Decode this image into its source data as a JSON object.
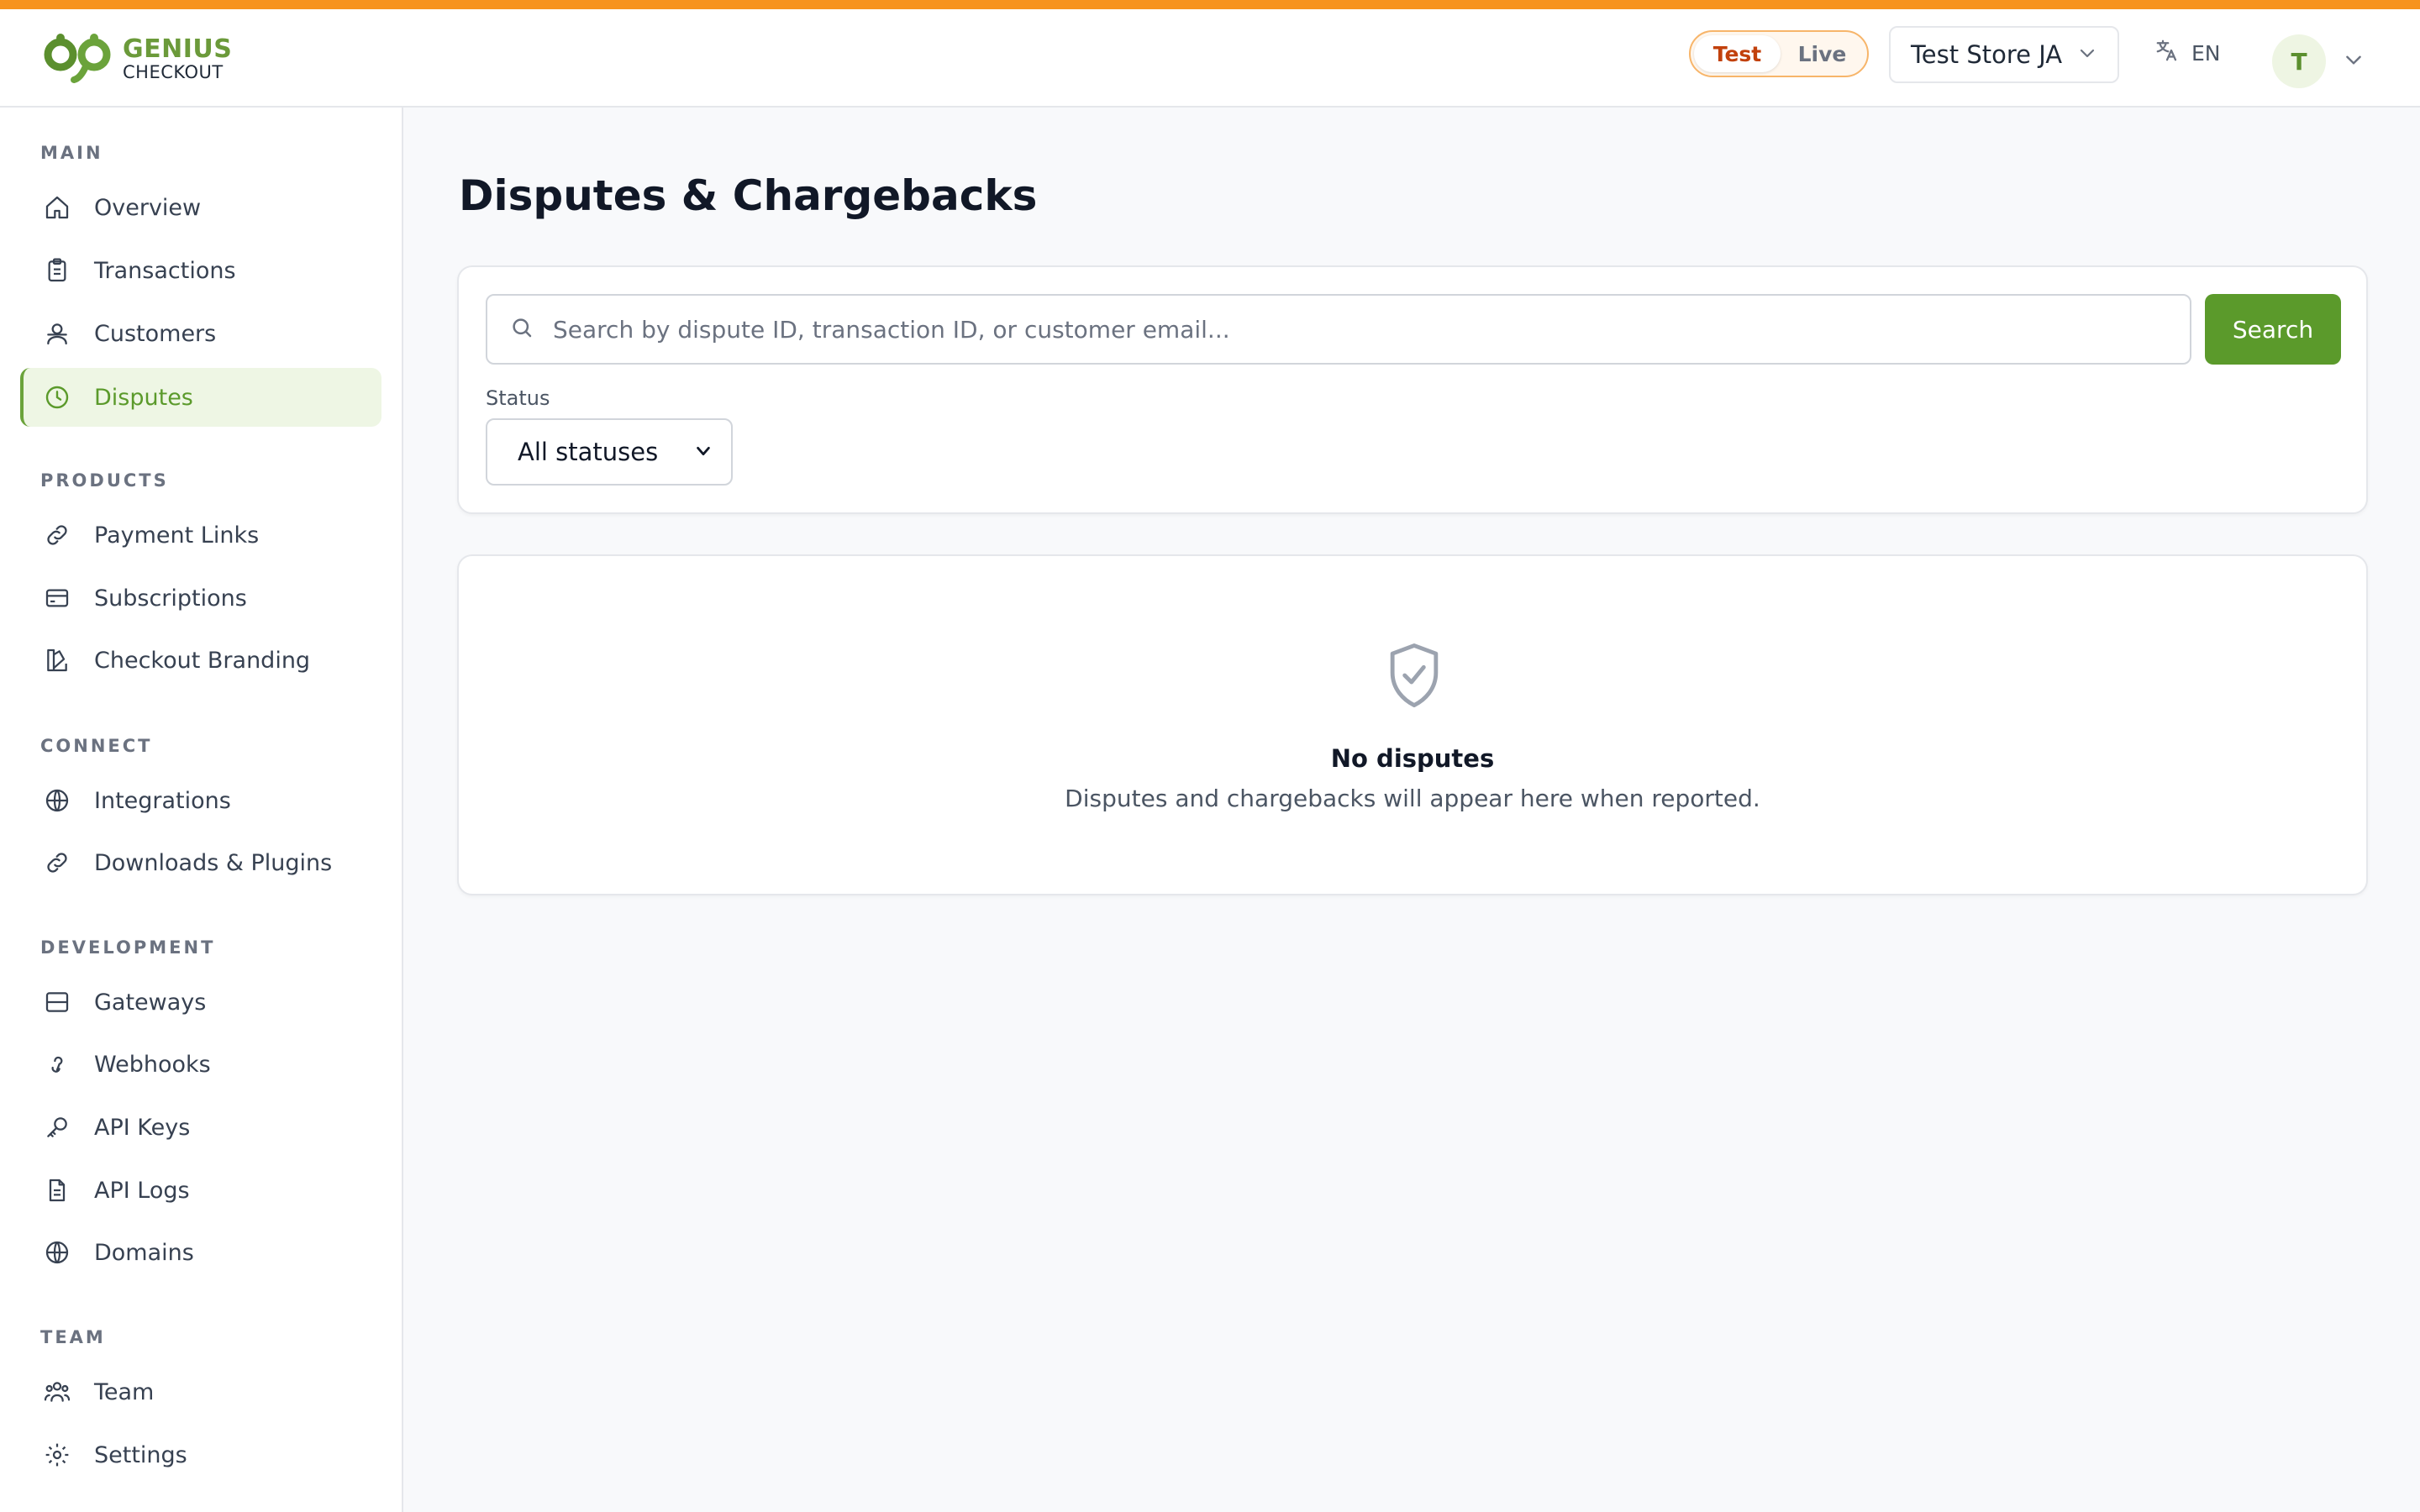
{
  "brand": {
    "line1": "GENIUS",
    "line2": "CHECKOUT",
    "accent_color": "#f7931e",
    "primary_color": "#5b9a2b"
  },
  "header": {
    "mode_toggle": {
      "test_label": "Test",
      "live_label": "Live",
      "selected": "Test"
    },
    "store_selector": {
      "value": "Test Store JA"
    },
    "language": {
      "label": "EN"
    },
    "user": {
      "avatar_initial": "T"
    }
  },
  "sidebar": {
    "sections": [
      {
        "title": "MAIN",
        "items": [
          {
            "label": "Overview",
            "icon": "home-icon"
          },
          {
            "label": "Transactions",
            "icon": "clipboard-icon"
          },
          {
            "label": "Customers",
            "icon": "users-icon"
          },
          {
            "label": "Disputes",
            "icon": "clock-icon",
            "active": true
          }
        ]
      },
      {
        "title": "PRODUCTS",
        "items": [
          {
            "label": "Payment Links",
            "icon": "link-icon"
          },
          {
            "label": "Subscriptions",
            "icon": "card-icon"
          },
          {
            "label": "Checkout Branding",
            "icon": "palette-icon"
          }
        ]
      },
      {
        "title": "CONNECT",
        "items": [
          {
            "label": "Integrations",
            "icon": "globe-icon"
          },
          {
            "label": "Downloads & Plugins",
            "icon": "link-icon"
          }
        ]
      },
      {
        "title": "DEVELOPMENT",
        "items": [
          {
            "label": "Gateways",
            "icon": "server-icon"
          },
          {
            "label": "Webhooks",
            "icon": "webhook-icon"
          },
          {
            "label": "API Keys",
            "icon": "key-icon"
          },
          {
            "label": "API Logs",
            "icon": "file-icon"
          },
          {
            "label": "Domains",
            "icon": "globe-icon"
          }
        ]
      },
      {
        "title": "TEAM",
        "items": [
          {
            "label": "Team",
            "icon": "team-icon"
          },
          {
            "label": "Settings",
            "icon": "gear-icon"
          }
        ]
      }
    ]
  },
  "main": {
    "title": "Disputes & Chargebacks",
    "search": {
      "placeholder": "Search by dispute ID, transaction ID, or customer email...",
      "value": "",
      "button_label": "Search"
    },
    "status_filter": {
      "label": "Status",
      "selected": "All statuses"
    },
    "empty_state": {
      "title": "No disputes",
      "subtitle": "Disputes and chargebacks will appear here when reported.",
      "icon": "shield-check-icon"
    }
  }
}
